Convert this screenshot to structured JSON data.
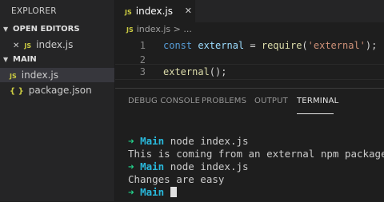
{
  "sidebar": {
    "title": "EXPLORER",
    "open_editors": {
      "heading": "OPEN EDITORS",
      "items": [
        {
          "badge": "JS",
          "name": "index.js"
        }
      ]
    },
    "project": {
      "heading": "MAIN",
      "items": [
        {
          "badge": "JS",
          "name": "index.js"
        },
        {
          "badge": "{ }",
          "name": "package.json"
        }
      ]
    }
  },
  "editor": {
    "tab": {
      "badge": "JS",
      "name": "index.js",
      "close": "✕"
    },
    "breadcrumb": {
      "badge": "JS",
      "file": "index.js",
      "sep": " > ..."
    },
    "lines": [
      {
        "num": "1",
        "tokens": {
          "kw": "const",
          "var": "external",
          "eq": " = ",
          "fn": "require",
          "open": "(",
          "str": "'external'",
          "close": ");"
        }
      },
      {
        "num": "2"
      },
      {
        "num": "3",
        "tokens": {
          "fn": "external",
          "rest": "();"
        }
      }
    ]
  },
  "panel": {
    "tabs": [
      "DEBUG CONSOLE",
      "PROBLEMS",
      "OUTPUT",
      "TERMINAL"
    ],
    "active_tab": "TERMINAL",
    "terminal": {
      "prompt_arrow": "➜",
      "prompt_dir": "Main",
      "lines": [
        {
          "type": "prompt",
          "cmd": "node index.js"
        },
        {
          "type": "output",
          "text": "This is coming from an external npm package"
        },
        {
          "type": "prompt",
          "cmd": "node index.js"
        },
        {
          "type": "output",
          "text": "Changes are easy"
        },
        {
          "type": "prompt",
          "cmd": ""
        }
      ]
    }
  },
  "colors": {
    "prompt_arrow": "#23d18b",
    "prompt_dir": "#29b8db",
    "js_badge": "#cbcb41"
  }
}
